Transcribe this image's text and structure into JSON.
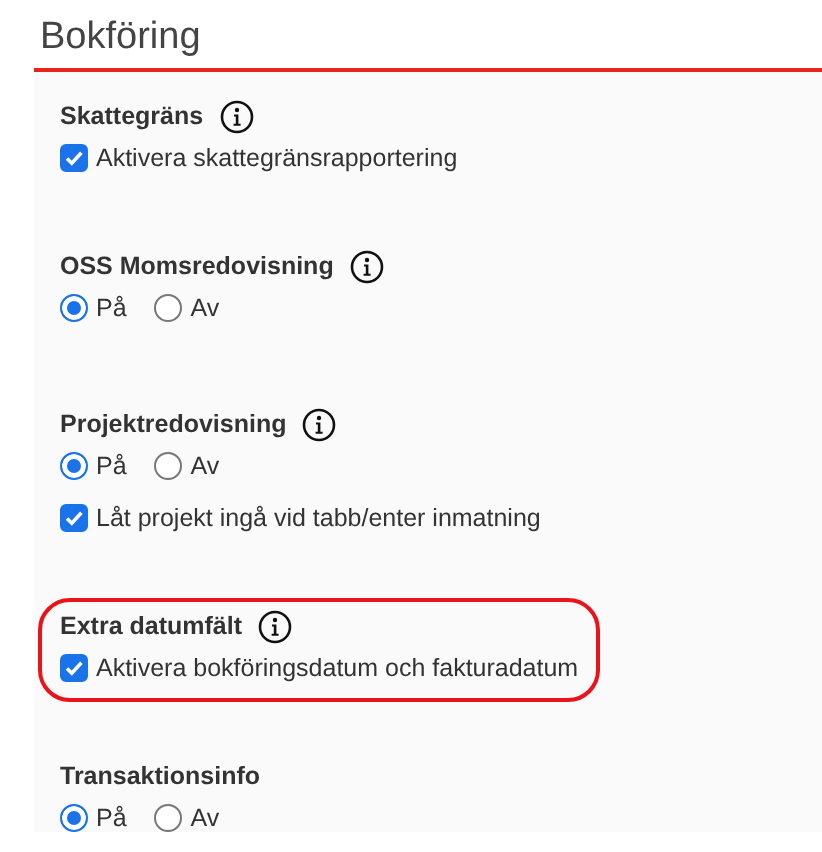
{
  "page": {
    "title": "Bokföring"
  },
  "sections": [
    {
      "title": "Skattegräns",
      "info": true,
      "highlighted": false,
      "controls": [
        {
          "kind": "checkbox",
          "label": "Aktivera skattegränsrapportering",
          "checked": true
        }
      ]
    },
    {
      "title": "OSS Momsredovisning",
      "info": true,
      "highlighted": false,
      "controls": [
        {
          "kind": "radio",
          "options": [
            {
              "label": "På",
              "selected": true
            },
            {
              "label": "Av",
              "selected": false
            }
          ]
        }
      ]
    },
    {
      "title": "Projektredovisning",
      "info": true,
      "highlighted": false,
      "controls": [
        {
          "kind": "radio",
          "options": [
            {
              "label": "På",
              "selected": true
            },
            {
              "label": "Av",
              "selected": false
            }
          ]
        },
        {
          "kind": "checkbox",
          "label": "Låt projekt ingå vid tabb/enter inmatning",
          "checked": true
        }
      ]
    },
    {
      "title": "Extra datumfält",
      "info": true,
      "highlighted": true,
      "controls": [
        {
          "kind": "checkbox",
          "label": "Aktivera bokföringsdatum och fakturadatum",
          "checked": true
        }
      ]
    },
    {
      "title": "Transaktionsinfo",
      "info": false,
      "highlighted": false,
      "controls": [
        {
          "kind": "radio",
          "options": [
            {
              "label": "På",
              "selected": true
            },
            {
              "label": "Av",
              "selected": false
            }
          ]
        }
      ]
    }
  ]
}
